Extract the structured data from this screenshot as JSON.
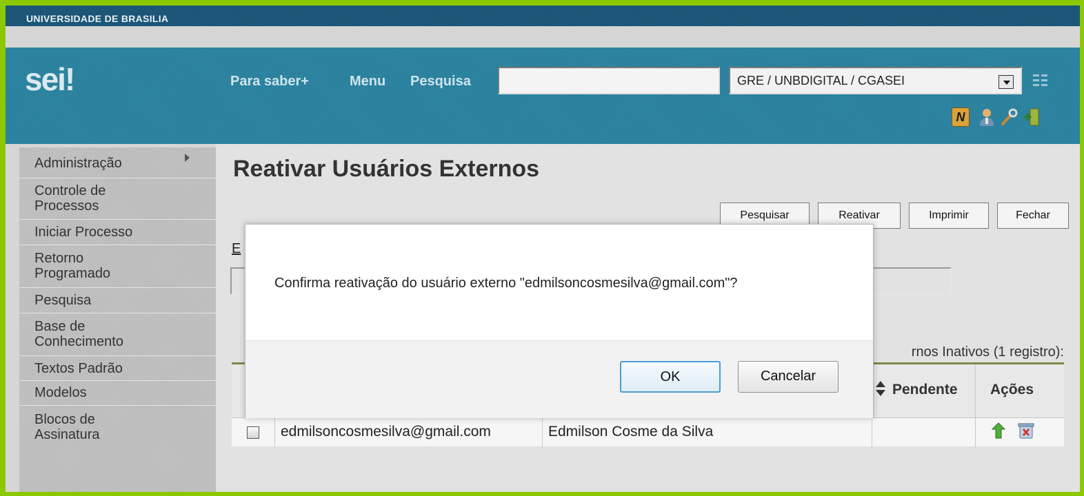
{
  "header": {
    "university": "UNIVERSIDADE DE BRASILIA",
    "logo": "sei!",
    "nav": [
      "Para saber+",
      "Menu",
      "Pesquisa"
    ],
    "search_value": "",
    "unit_selected": "GRE / UNBDIGITAL / CGASEI",
    "user_icons": [
      "n-icon",
      "user-icon",
      "wrench-icon",
      "exit-icon"
    ]
  },
  "sidebar": {
    "items": [
      {
        "label": "Administração",
        "submenu": true
      },
      {
        "label": "Controle de Processos"
      },
      {
        "label": "Iniciar Processo"
      },
      {
        "label": "Retorno Programado"
      },
      {
        "label": "Pesquisa"
      },
      {
        "label": "Base de Conhecimento"
      },
      {
        "label": "Textos Padrão"
      },
      {
        "label": "Modelos"
      },
      {
        "label": "Blocos de Assinatura"
      }
    ]
  },
  "main": {
    "title": "Reativar Usuários Externos",
    "buttons": {
      "pesquisar": "Pesquisar",
      "reativar": "Reativar",
      "imprimir": "Imprimir",
      "fechar": "Fechar"
    },
    "filter_label_visible": "E",
    "table_caption_visible": "rnos Inativos (1 registro):",
    "table": {
      "headers": {
        "pendente": "Pendente",
        "acoes": "Ações"
      },
      "rows": [
        {
          "email": "edmilsoncosmesilva@gmail.com",
          "name": "Edmilson Cosme da Silva",
          "pendente": ""
        }
      ]
    }
  },
  "dialog": {
    "message": "Confirma reativação do usuário externo \"edmilsoncosmesilva@gmail.com\"?",
    "ok_label": "OK",
    "cancel_label": "Cancelar"
  },
  "colors": {
    "outer_border": "#8cc800",
    "top_bar": "#1d587a",
    "header": "#2d86a3",
    "sidebar": "#c3c3c3",
    "table_top_rule": "#7d8a49"
  }
}
